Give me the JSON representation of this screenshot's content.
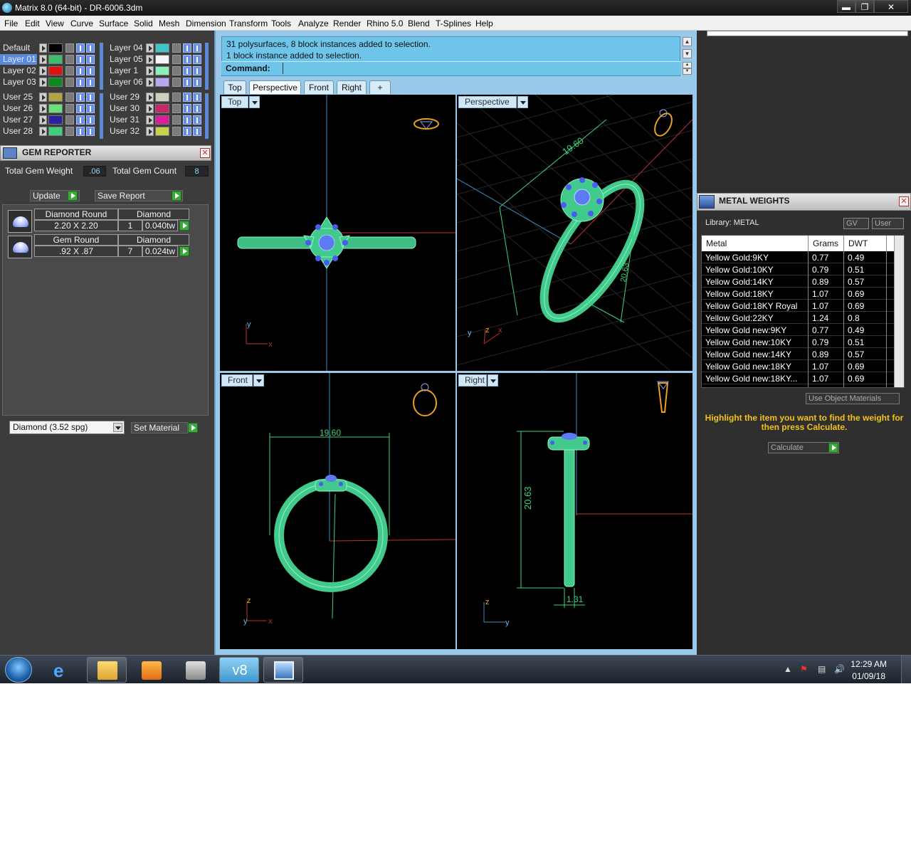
{
  "window": {
    "title": "Matrix 8.0 (64-bit) - DR-6006.3dm",
    "min": "▬",
    "max": "❐",
    "close": "✕"
  },
  "menu": [
    "File",
    "Edit",
    "View",
    "Curve",
    "Surface",
    "Solid",
    "Mesh",
    "Dimension",
    "Transform",
    "Tools",
    "Analyze",
    "Render",
    "Rhino 5.0",
    "Blend",
    "T-Splines",
    "Help"
  ],
  "layers": {
    "left": [
      {
        "name": "Default",
        "color": "#000000"
      },
      {
        "name": "Layer 01",
        "color": "#3dbd6b"
      },
      {
        "name": "Layer 02",
        "color": "#e21010"
      },
      {
        "name": "Layer 03",
        "color": "#0a8a1c"
      },
      {
        "name": "User 25",
        "color": "#b0a545"
      },
      {
        "name": "User 26",
        "color": "#6be07a"
      },
      {
        "name": "User 27",
        "color": "#2a1fa0"
      },
      {
        "name": "User 28",
        "color": "#3dcf7a"
      }
    ],
    "right": [
      {
        "name": "Layer 04",
        "color": "#3cc8c8"
      },
      {
        "name": "Layer 05",
        "color": "#f5f5f5"
      },
      {
        "name": "Layer 1",
        "color": "#88f0b8"
      },
      {
        "name": "Layer 06",
        "color": "#b9a6f0"
      },
      {
        "name": "User 29",
        "color": "#cfcfc0"
      },
      {
        "name": "User 30",
        "color": "#c42a6a"
      },
      {
        "name": "User 31",
        "color": "#e01aa0"
      },
      {
        "name": "User 32",
        "color": "#c8d24a"
      }
    ]
  },
  "gem_reporter": {
    "title": "GEM REPORTER",
    "total_weight_label": "Total Gem Weight",
    "total_weight": ".06",
    "total_count_label": "Total Gem Count",
    "total_count": "8",
    "update": "Update",
    "save_report": "Save Report",
    "rows": [
      {
        "shape": "Diamond Round",
        "size": "2.20 X 2.20",
        "material": "Diamond",
        "qty": "1",
        "weight": "0.040tw"
      },
      {
        "shape": "Gem Round",
        "size": ".92 X .87",
        "material": "Diamond",
        "qty": "7",
        "weight": "0.024tw"
      }
    ],
    "material_select": "Diamond     (3.52 spg)",
    "set_material": "Set Material"
  },
  "command": {
    "line1": "31 polysurfaces, 8 block instances added to selection.",
    "line2": "1 block instance added to selection.",
    "label": "Command:"
  },
  "view_tabs": [
    "Top",
    "Perspective",
    "Front",
    "Right",
    "+"
  ],
  "viewports": {
    "top": {
      "label": "Top",
      "axis_v": "y",
      "axis_h": "x"
    },
    "perspective": {
      "label": "Perspective",
      "dim1": "19.60",
      "dim2": "20.63",
      "axis_a": "y",
      "axis_b": "z",
      "axis_c": "x"
    },
    "front": {
      "label": "Front",
      "dim": "19.60",
      "axis_v": "z",
      "axis_h": "x",
      "axis_o": "y"
    },
    "right": {
      "label": "Right",
      "dim1": "20.63",
      "dim2": "1.31",
      "axis_v": "z",
      "axis_h": "y"
    }
  },
  "metal_weights": {
    "title": "METAL WEIGHTS",
    "library": "Library: METAL",
    "gv": "GV",
    "user": "User",
    "headers": [
      "Metal",
      "Grams",
      "DWT"
    ],
    "rows": [
      {
        "metal": "Yellow Gold:9KY",
        "grams": "0.77",
        "dwt": "0.49"
      },
      {
        "metal": "Yellow Gold:10KY",
        "grams": "0.79",
        "dwt": "0.51"
      },
      {
        "metal": "Yellow Gold:14KY",
        "grams": "0.89",
        "dwt": "0.57"
      },
      {
        "metal": "Yellow Gold:18KY",
        "grams": "1.07",
        "dwt": "0.69"
      },
      {
        "metal": "Yellow Gold:18KY Royal",
        "grams": "1.07",
        "dwt": "0.69"
      },
      {
        "metal": "Yellow Gold:22KY",
        "grams": "1.24",
        "dwt": "0.8"
      },
      {
        "metal": "Yellow Gold new:9KY",
        "grams": "0.77",
        "dwt": "0.49"
      },
      {
        "metal": "Yellow Gold new:10KY",
        "grams": "0.79",
        "dwt": "0.51"
      },
      {
        "metal": "Yellow Gold new:14KY",
        "grams": "0.89",
        "dwt": "0.57"
      },
      {
        "metal": "Yellow Gold new:18KY",
        "grams": "1.07",
        "dwt": "0.69"
      },
      {
        "metal": "Yellow Gold new:18KY...",
        "grams": "1.07",
        "dwt": "0.69"
      }
    ],
    "use_object_materials": "Use Object Materials",
    "hint": "Highlight the item you want to find the weight for then press Calculate.",
    "calculate": "Calculate"
  },
  "taskbar": {
    "time": "12:29 AM",
    "date": "01/09/18"
  },
  "colors": {
    "model_green": "#45c98a",
    "dim_green": "#3fd17f",
    "accent_blue": "#6fc4ea",
    "hint_yellow": "#f2c21b"
  }
}
